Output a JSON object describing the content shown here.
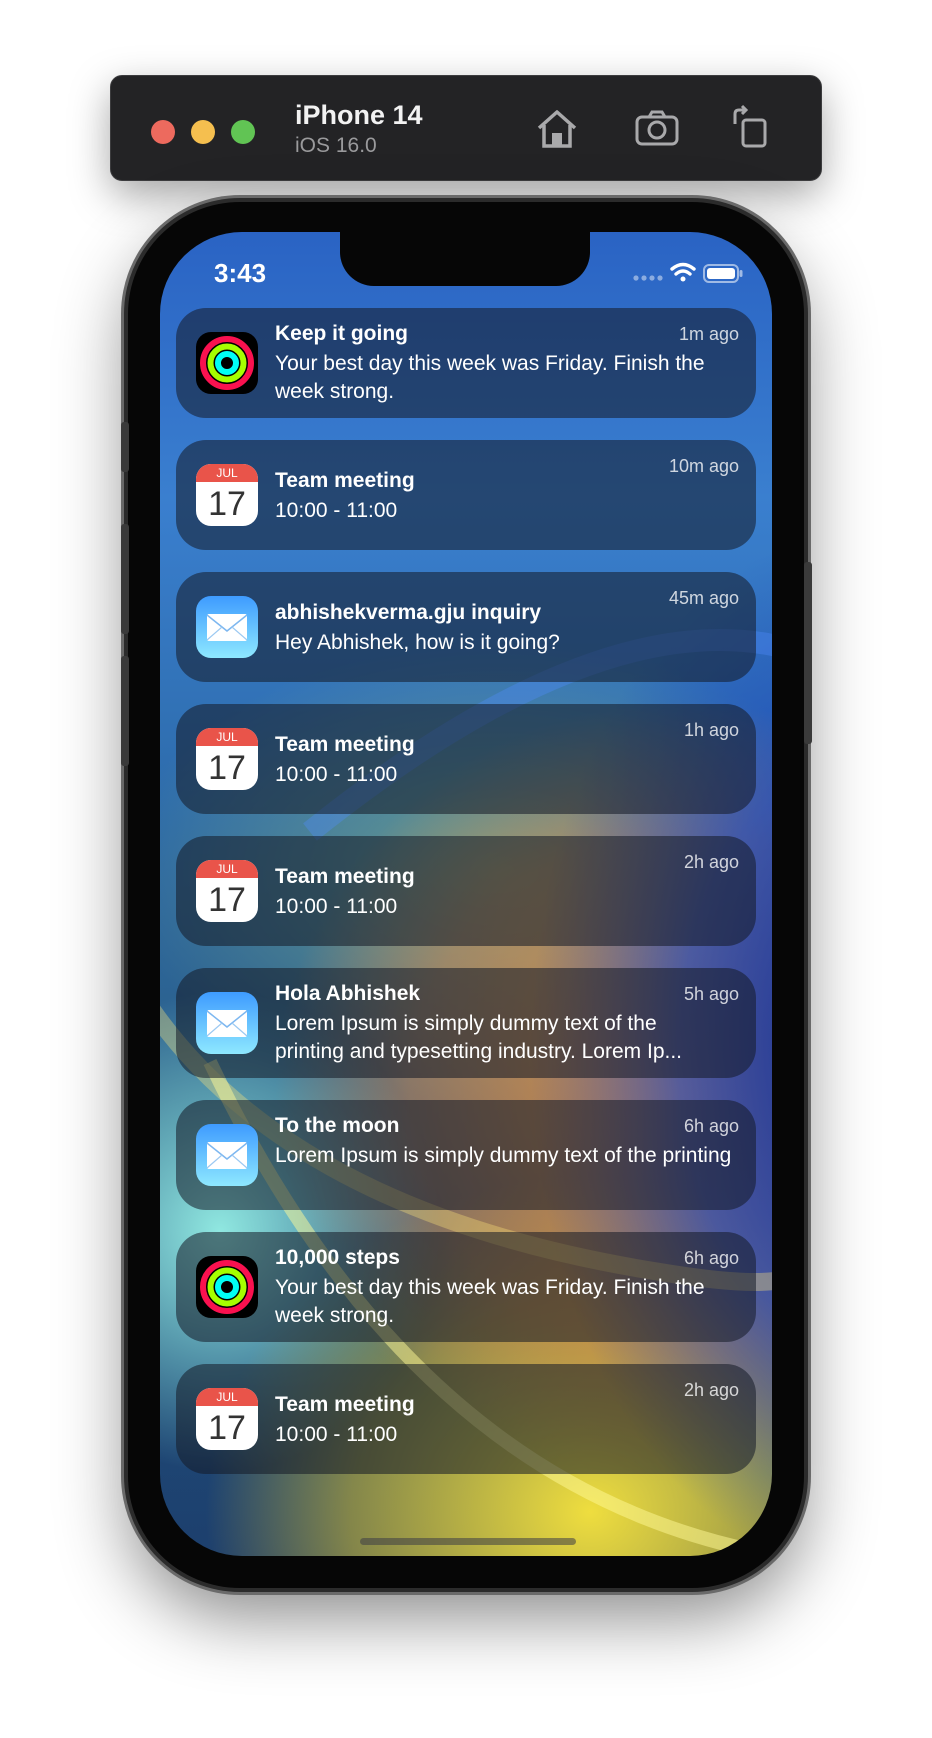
{
  "simulator": {
    "device_name": "iPhone 14",
    "os_version": "iOS 16.0",
    "toolbar": [
      "home-icon",
      "screenshot-camera-icon",
      "rotate-icon"
    ]
  },
  "status_bar": {
    "time": "3:43",
    "icons": [
      "signal-dots-icon",
      "wifi-icon",
      "battery-icon"
    ]
  },
  "calendar_icon": {
    "month": "JUL",
    "day": "17"
  },
  "notifications": [
    {
      "app": "activity",
      "title": "Keep it going",
      "body": "Your best day this week was Friday. Finish the week strong.",
      "time": "1m ago"
    },
    {
      "app": "calendar",
      "title": "Team meeting",
      "body": "10:00 - 11:00",
      "time": "10m ago"
    },
    {
      "app": "mail",
      "title": "abhishekverma.gju inquiry",
      "body": "Hey Abhishek, how is it going?",
      "time": "45m ago"
    },
    {
      "app": "calendar",
      "title": "Team meeting",
      "body": "10:00 - 11:00",
      "time": "1h ago"
    },
    {
      "app": "calendar",
      "title": "Team meeting",
      "body": "10:00 - 11:00",
      "time": "2h ago"
    },
    {
      "app": "mail",
      "title": "Hola Abhishek",
      "body_line1": "Lorem Ipsum is simply dummy text of the",
      "body_line2": "printing and typesetting industry. Lorem Ip...",
      "time": "5h ago"
    },
    {
      "app": "mail",
      "title": "To the moon",
      "body": "Lorem Ipsum is simply dummy text of the printing",
      "time": "6h ago"
    },
    {
      "app": "activity",
      "title": "10,000 steps",
      "body": "Your best day this week was Friday. Finish the week strong.",
      "time": "6h ago"
    },
    {
      "app": "calendar",
      "title": "Team meeting",
      "body": "10:00 - 11:00",
      "time": "2h ago"
    }
  ],
  "colors": {
    "activity_move": "#fa114f",
    "activity_exercise": "#a6ff00",
    "activity_stand": "#00fff6",
    "mail_top": "#3e9bff",
    "mail_bottom": "#8ee8ff",
    "calendar_red": "#e9544a"
  }
}
